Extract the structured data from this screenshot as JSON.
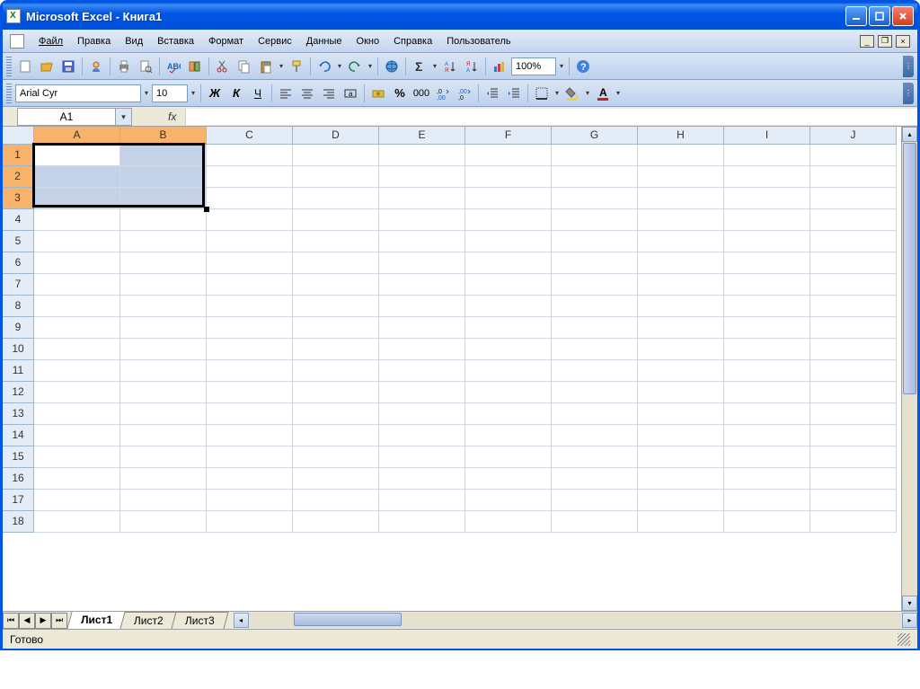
{
  "window": {
    "title": "Microsoft Excel - Книга1"
  },
  "menu": {
    "items": [
      "Файл",
      "Правка",
      "Вид",
      "Вставка",
      "Формат",
      "Сервис",
      "Данные",
      "Окно",
      "Справка",
      "Пользователь"
    ]
  },
  "toolbar": {
    "zoom": "100%"
  },
  "formatbar": {
    "font": "Arial Cyr",
    "size": "10"
  },
  "formula": {
    "cellref": "A1",
    "fx": "fx",
    "value": ""
  },
  "grid": {
    "columns": [
      "A",
      "B",
      "C",
      "D",
      "E",
      "F",
      "G",
      "H",
      "I",
      "J"
    ],
    "rows": [
      1,
      2,
      3,
      4,
      5,
      6,
      7,
      8,
      9,
      10,
      11,
      12,
      13,
      14,
      15,
      16,
      17,
      18
    ],
    "selected_cols": [
      "A",
      "B"
    ],
    "selected_rows": [
      1,
      2,
      3
    ],
    "active_cell": "A1"
  },
  "sheets": {
    "tabs": [
      "Лист1",
      "Лист2",
      "Лист3"
    ],
    "active": "Лист1"
  },
  "status": {
    "text": "Готово"
  }
}
